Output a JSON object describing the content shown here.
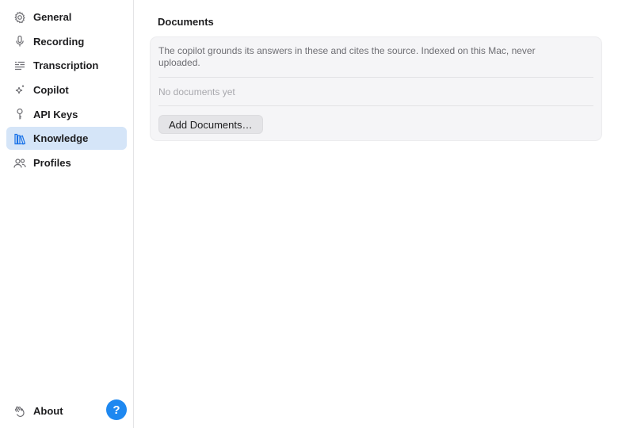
{
  "sidebar": {
    "items": [
      {
        "label": "General",
        "icon": "gear-icon"
      },
      {
        "label": "Recording",
        "icon": "microphone-icon"
      },
      {
        "label": "Transcription",
        "icon": "transcript-lines-icon"
      },
      {
        "label": "Copilot",
        "icon": "sparkles-icon"
      },
      {
        "label": "API Keys",
        "icon": "key-icon"
      },
      {
        "label": "Knowledge",
        "icon": "books-icon",
        "active": true
      },
      {
        "label": "Profiles",
        "icon": "people-icon"
      }
    ],
    "about_label": "About",
    "help_label": "?"
  },
  "main": {
    "section_title": "Documents",
    "description": "The copilot grounds its answers in these and cites the source. Indexed on this Mac, never uploaded.",
    "empty_state": "No documents yet",
    "add_button_label": "Add Documents…"
  },
  "colors": {
    "accent": "#1e88f0",
    "active_bg": "#d5e5f8"
  }
}
